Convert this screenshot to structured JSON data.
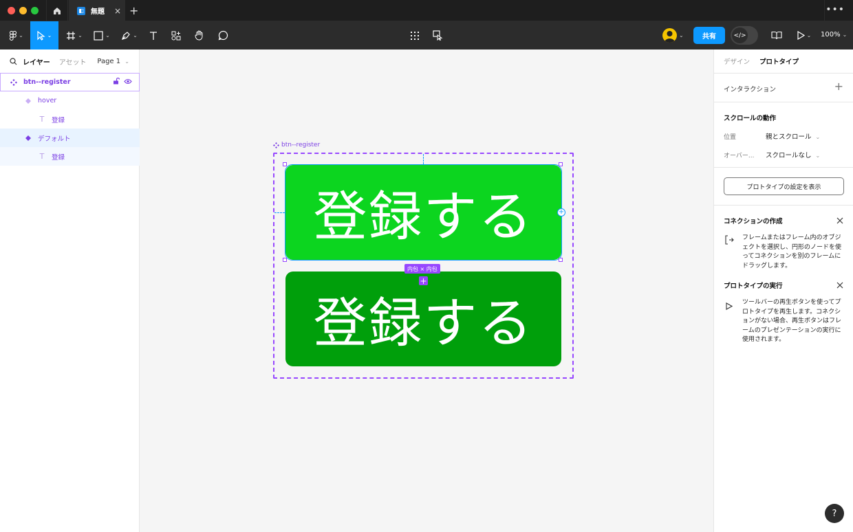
{
  "titlebar": {
    "file_tab_name": "無題",
    "file_tab_close": "×",
    "new_tab": "+",
    "more": "•••"
  },
  "toolbar": {
    "share_label": "共有",
    "zoom_label": "100%"
  },
  "left_panel": {
    "tab_layers": "レイヤー",
    "tab_assets": "アセット",
    "page_selector": "Page 1",
    "layers": [
      {
        "name": "btn--register"
      },
      {
        "name": "hover"
      },
      {
        "name": "登録"
      },
      {
        "name": "デフォルト"
      },
      {
        "name": "登録"
      }
    ]
  },
  "canvas": {
    "frame_label": "btn--register",
    "button_hover_text": "登録する",
    "button_default_text": "登録する",
    "size_badge": "内包 × 内包"
  },
  "right_panel": {
    "tab_design": "デザイン",
    "tab_prototype": "プロトタイプ",
    "interaction_title": "インタラクション",
    "scroll_title": "スクロールの動作",
    "position_label": "位置",
    "position_value": "親とスクロール",
    "overflow_label": "オーバー...",
    "overflow_value": "スクロールなし",
    "settings_button": "プロトタイプの設定を表示",
    "connection_title": "コネクションの作成",
    "connection_desc": "フレームまたはフレーム内のオブジェクトを選択し、円形のノードを使ってコネクションを別のフレームにドラッグします。",
    "run_title": "プロトタイプの実行",
    "run_desc": "ツールバーの再生ボタンを使ってプロトタイプを再生します。コネクションがない場合、再生ボタンはフレームのプレゼンテーションの実行に使用されます。"
  },
  "help": "?",
  "colors": {
    "accent": "#0d99ff",
    "component": "#9747ff",
    "button_hover": "#0cd51f",
    "button_default": "#009f0b"
  }
}
